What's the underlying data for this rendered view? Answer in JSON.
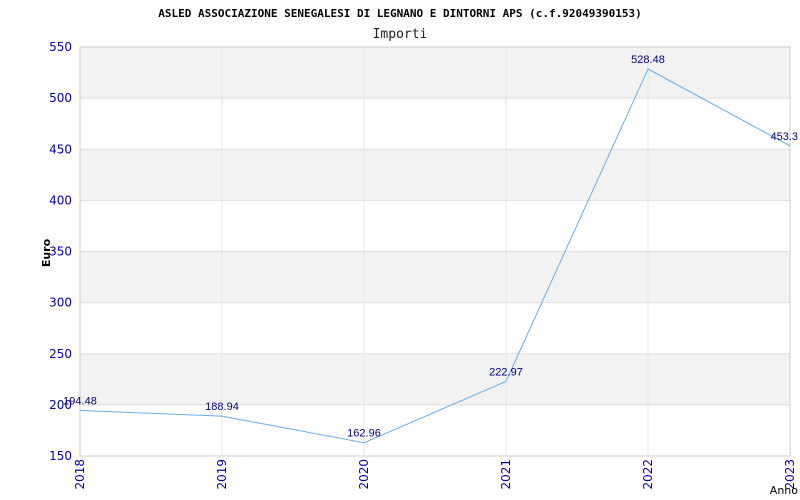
{
  "chart_data": {
    "type": "line",
    "title": "ASLED ASSOCIAZIONE SENEGALESI DI LEGNANO E DINTORNI APS (c.f.92049390153)",
    "subtitle": "Importi",
    "xlabel": "Anno",
    "ylabel": "Euro",
    "categories": [
      "2018",
      "2019",
      "2020",
      "2021",
      "2022",
      "2023"
    ],
    "series": [
      {
        "values": [
          194.48,
          188.94,
          162.96,
          222.97,
          528.48,
          453.3
        ],
        "labels": [
          "194.48",
          "188.94",
          "162.96",
          "222.97",
          "528.48",
          "453.3"
        ]
      }
    ],
    "ylim": [
      150,
      550
    ],
    "yticks": [
      150,
      200,
      250,
      300,
      350,
      400,
      450,
      500,
      550
    ],
    "grid": true,
    "colors": {
      "line": "#6aaee8",
      "band": "#f2f2f2",
      "tick_text": "#0000aa",
      "data_label": "#000080"
    }
  }
}
